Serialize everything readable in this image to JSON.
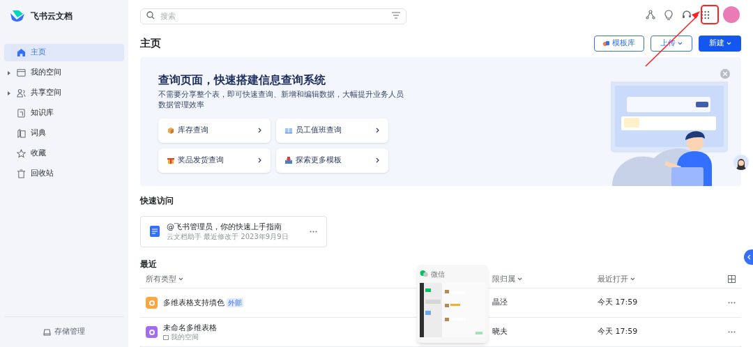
{
  "app": {
    "name": "飞书云文档"
  },
  "sidebar": {
    "items": [
      {
        "label": "主页",
        "selected": true,
        "has_children": false
      },
      {
        "label": "我的空间",
        "selected": false,
        "has_children": true
      },
      {
        "label": "共享空间",
        "selected": false,
        "has_children": true
      },
      {
        "label": "知识库",
        "selected": false,
        "has_children": false
      },
      {
        "label": "词典",
        "selected": false,
        "has_children": false
      },
      {
        "label": "收藏",
        "selected": false,
        "has_children": false
      },
      {
        "label": "回收站",
        "selected": false,
        "has_children": false
      }
    ],
    "footer": "存储管理"
  },
  "search": {
    "placeholder": "搜索"
  },
  "page_title": "主页",
  "actions": [
    {
      "label": "模板库",
      "kind": "template"
    },
    {
      "label": "上传",
      "kind": "outline"
    },
    {
      "label": "新建",
      "kind": "primary"
    }
  ],
  "banner": {
    "title": "查询页面，快速搭建信息查询系统",
    "description": "不需要分享整个表，即可快速查询、新增和编辑数据，大幅提升业务人员数据管理效率",
    "links": [
      {
        "label": "库存查询"
      },
      {
        "label": "员工值班查询"
      },
      {
        "label": "奖品发货查询"
      },
      {
        "label": "探索更多模板"
      }
    ]
  },
  "quick_access": {
    "title": "快速访问",
    "items": [
      {
        "title": "@飞书管理员，你的快速上手指南",
        "meta": "云文档助手 最近修改于 2023年9月9日"
      }
    ]
  },
  "recent": {
    "title": "最近",
    "columns": [
      "所有类型",
      "限归属",
      "最近打开"
    ],
    "rows": [
      {
        "name": "多维表格支持填色",
        "badge": "外部",
        "owner": "晶泾",
        "opened": "今天 17:59"
      },
      {
        "name": "未命名多维表格",
        "location": "我的空间",
        "owner": "晓夫",
        "opened": "今天 17:59"
      }
    ]
  },
  "taskbar_preview": {
    "title": "微信"
  }
}
